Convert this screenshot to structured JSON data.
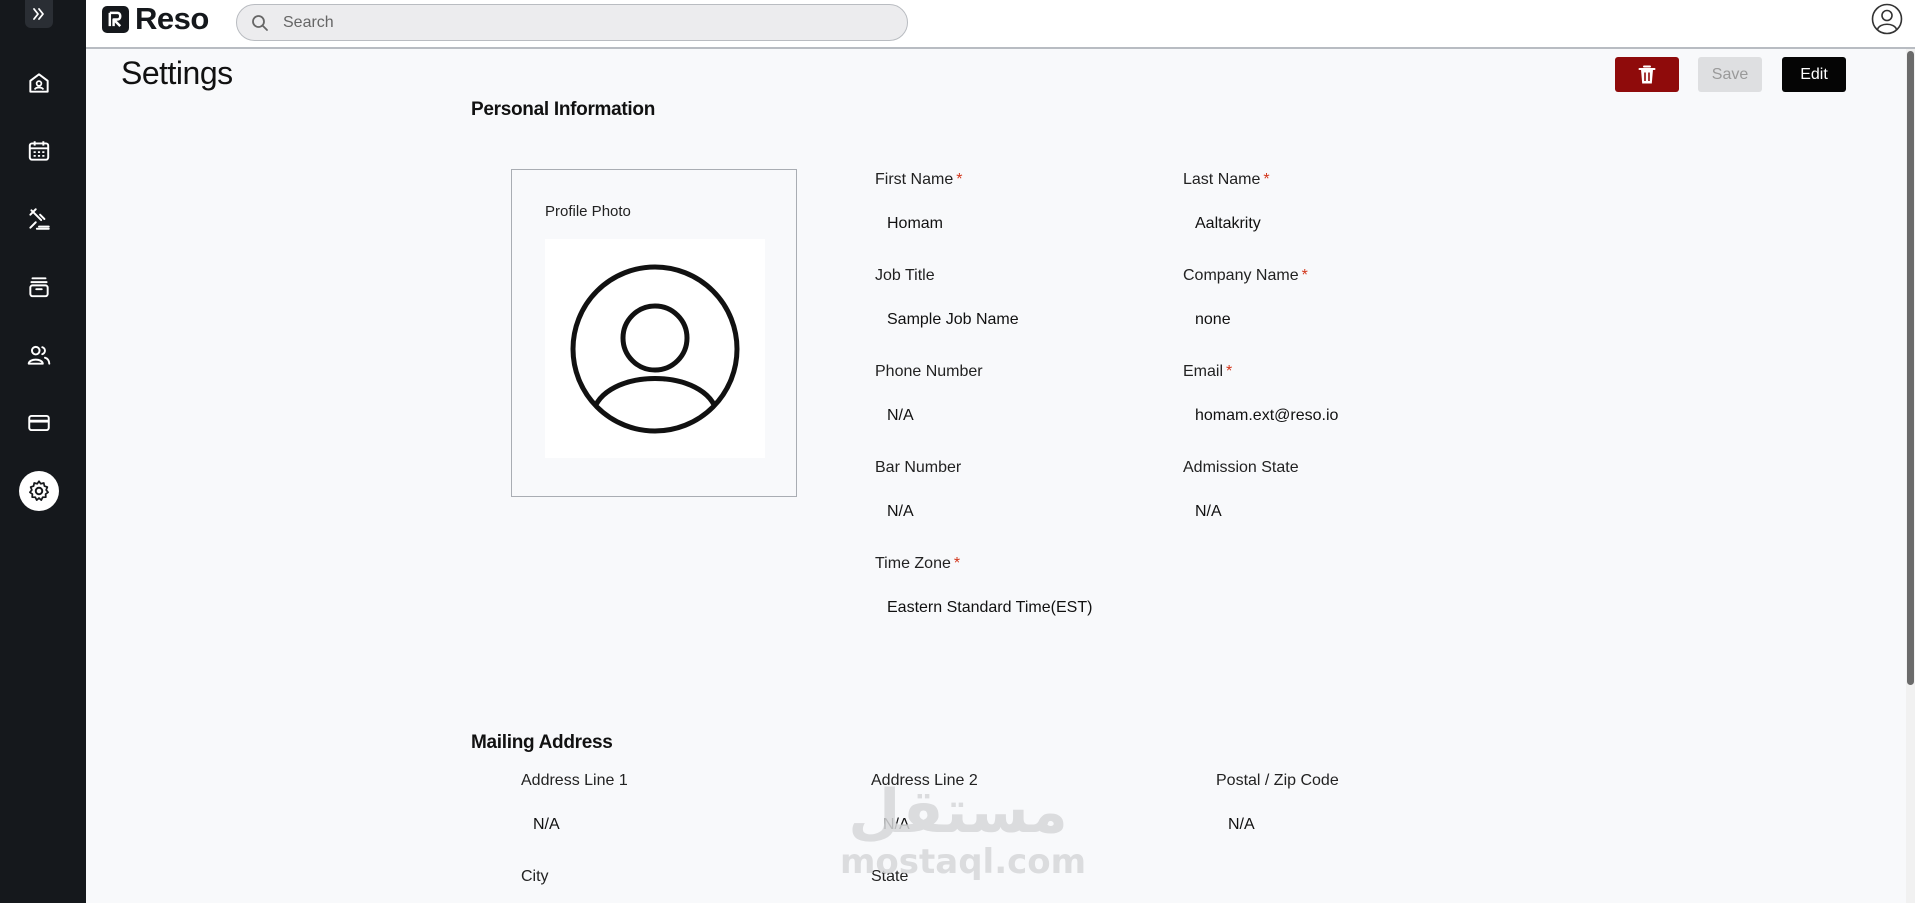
{
  "app": {
    "name": "Reso"
  },
  "search": {
    "placeholder": "Search"
  },
  "sidebar": {
    "items": [
      {
        "icon": "home-icon"
      },
      {
        "icon": "calendar-icon"
      },
      {
        "icon": "gavel-icon"
      },
      {
        "icon": "archive-icon"
      },
      {
        "icon": "users-icon"
      },
      {
        "icon": "credit-card-icon"
      },
      {
        "icon": "gear-icon",
        "active": true
      }
    ]
  },
  "page": {
    "title": "Settings"
  },
  "actions": {
    "save_label": "Save",
    "edit_label": "Edit",
    "delete_color": "#8f0b0b"
  },
  "personal": {
    "title": "Personal Information",
    "photo_label": "Profile Photo",
    "first_name": {
      "label": "First Name",
      "value": "Homam"
    },
    "last_name": {
      "label": "Last Name",
      "value": "Aaltakrity"
    },
    "job_title": {
      "label": "Job Title",
      "value": "Sample Job Name"
    },
    "company_name": {
      "label": "Company Name",
      "value": "none"
    },
    "phone_number": {
      "label": "Phone Number",
      "value": "N/A"
    },
    "email": {
      "label": "Email",
      "value": "homam.ext@reso.io"
    },
    "bar_number": {
      "label": "Bar Number",
      "value": "N/A"
    },
    "admission_state": {
      "label": "Admission State",
      "value": "N/A"
    },
    "time_zone": {
      "label": "Time Zone",
      "value": "Eastern Standard Time(EST)"
    },
    "required_marker": "*"
  },
  "mailing": {
    "title": "Mailing Address",
    "address_line_1": {
      "label": "Address Line 1",
      "value": "N/A"
    },
    "address_line_2": {
      "label": "Address Line 2",
      "value": "N/A"
    },
    "postal_code": {
      "label": "Postal / Zip Code",
      "value": "N/A"
    },
    "city": {
      "label": "City"
    },
    "state": {
      "label": "State"
    }
  },
  "watermark": {
    "arabic": "مستقل",
    "latin": "mostaql.com"
  }
}
